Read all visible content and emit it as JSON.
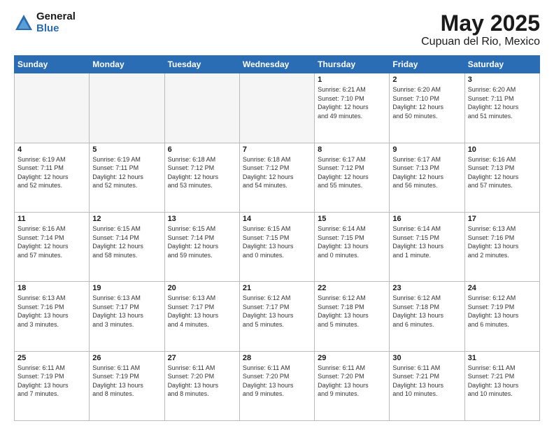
{
  "logo": {
    "general": "General",
    "blue": "Blue"
  },
  "title": "May 2025",
  "subtitle": "Cupuan del Rio, Mexico",
  "weekdays": [
    "Sunday",
    "Monday",
    "Tuesday",
    "Wednesday",
    "Thursday",
    "Friday",
    "Saturday"
  ],
  "weeks": [
    [
      {
        "day": "",
        "info": ""
      },
      {
        "day": "",
        "info": ""
      },
      {
        "day": "",
        "info": ""
      },
      {
        "day": "",
        "info": ""
      },
      {
        "day": "1",
        "info": "Sunrise: 6:21 AM\nSunset: 7:10 PM\nDaylight: 12 hours\nand 49 minutes."
      },
      {
        "day": "2",
        "info": "Sunrise: 6:20 AM\nSunset: 7:10 PM\nDaylight: 12 hours\nand 50 minutes."
      },
      {
        "day": "3",
        "info": "Sunrise: 6:20 AM\nSunset: 7:11 PM\nDaylight: 12 hours\nand 51 minutes."
      }
    ],
    [
      {
        "day": "4",
        "info": "Sunrise: 6:19 AM\nSunset: 7:11 PM\nDaylight: 12 hours\nand 52 minutes."
      },
      {
        "day": "5",
        "info": "Sunrise: 6:19 AM\nSunset: 7:11 PM\nDaylight: 12 hours\nand 52 minutes."
      },
      {
        "day": "6",
        "info": "Sunrise: 6:18 AM\nSunset: 7:12 PM\nDaylight: 12 hours\nand 53 minutes."
      },
      {
        "day": "7",
        "info": "Sunrise: 6:18 AM\nSunset: 7:12 PM\nDaylight: 12 hours\nand 54 minutes."
      },
      {
        "day": "8",
        "info": "Sunrise: 6:17 AM\nSunset: 7:12 PM\nDaylight: 12 hours\nand 55 minutes."
      },
      {
        "day": "9",
        "info": "Sunrise: 6:17 AM\nSunset: 7:13 PM\nDaylight: 12 hours\nand 56 minutes."
      },
      {
        "day": "10",
        "info": "Sunrise: 6:16 AM\nSunset: 7:13 PM\nDaylight: 12 hours\nand 57 minutes."
      }
    ],
    [
      {
        "day": "11",
        "info": "Sunrise: 6:16 AM\nSunset: 7:14 PM\nDaylight: 12 hours\nand 57 minutes."
      },
      {
        "day": "12",
        "info": "Sunrise: 6:15 AM\nSunset: 7:14 PM\nDaylight: 12 hours\nand 58 minutes."
      },
      {
        "day": "13",
        "info": "Sunrise: 6:15 AM\nSunset: 7:14 PM\nDaylight: 12 hours\nand 59 minutes."
      },
      {
        "day": "14",
        "info": "Sunrise: 6:15 AM\nSunset: 7:15 PM\nDaylight: 13 hours\nand 0 minutes."
      },
      {
        "day": "15",
        "info": "Sunrise: 6:14 AM\nSunset: 7:15 PM\nDaylight: 13 hours\nand 0 minutes."
      },
      {
        "day": "16",
        "info": "Sunrise: 6:14 AM\nSunset: 7:15 PM\nDaylight: 13 hours\nand 1 minute."
      },
      {
        "day": "17",
        "info": "Sunrise: 6:13 AM\nSunset: 7:16 PM\nDaylight: 13 hours\nand 2 minutes."
      }
    ],
    [
      {
        "day": "18",
        "info": "Sunrise: 6:13 AM\nSunset: 7:16 PM\nDaylight: 13 hours\nand 3 minutes."
      },
      {
        "day": "19",
        "info": "Sunrise: 6:13 AM\nSunset: 7:17 PM\nDaylight: 13 hours\nand 3 minutes."
      },
      {
        "day": "20",
        "info": "Sunrise: 6:13 AM\nSunset: 7:17 PM\nDaylight: 13 hours\nand 4 minutes."
      },
      {
        "day": "21",
        "info": "Sunrise: 6:12 AM\nSunset: 7:17 PM\nDaylight: 13 hours\nand 5 minutes."
      },
      {
        "day": "22",
        "info": "Sunrise: 6:12 AM\nSunset: 7:18 PM\nDaylight: 13 hours\nand 5 minutes."
      },
      {
        "day": "23",
        "info": "Sunrise: 6:12 AM\nSunset: 7:18 PM\nDaylight: 13 hours\nand 6 minutes."
      },
      {
        "day": "24",
        "info": "Sunrise: 6:12 AM\nSunset: 7:19 PM\nDaylight: 13 hours\nand 6 minutes."
      }
    ],
    [
      {
        "day": "25",
        "info": "Sunrise: 6:11 AM\nSunset: 7:19 PM\nDaylight: 13 hours\nand 7 minutes."
      },
      {
        "day": "26",
        "info": "Sunrise: 6:11 AM\nSunset: 7:19 PM\nDaylight: 13 hours\nand 8 minutes."
      },
      {
        "day": "27",
        "info": "Sunrise: 6:11 AM\nSunset: 7:20 PM\nDaylight: 13 hours\nand 8 minutes."
      },
      {
        "day": "28",
        "info": "Sunrise: 6:11 AM\nSunset: 7:20 PM\nDaylight: 13 hours\nand 9 minutes."
      },
      {
        "day": "29",
        "info": "Sunrise: 6:11 AM\nSunset: 7:20 PM\nDaylight: 13 hours\nand 9 minutes."
      },
      {
        "day": "30",
        "info": "Sunrise: 6:11 AM\nSunset: 7:21 PM\nDaylight: 13 hours\nand 10 minutes."
      },
      {
        "day": "31",
        "info": "Sunrise: 6:11 AM\nSunset: 7:21 PM\nDaylight: 13 hours\nand 10 minutes."
      }
    ]
  ]
}
